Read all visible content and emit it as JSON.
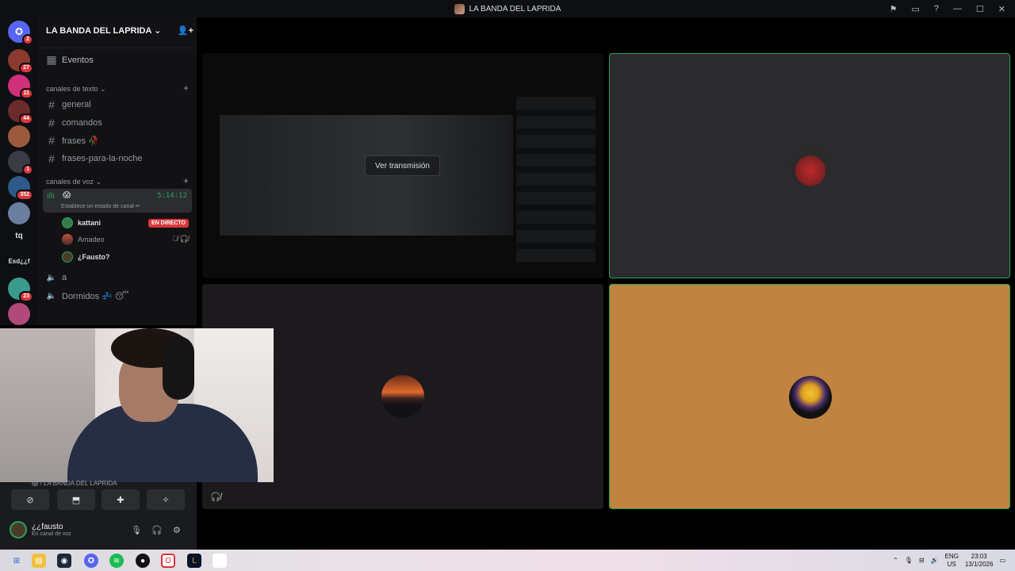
{
  "window": {
    "title": "LA BANDA DEL LAPRIDA"
  },
  "servers": {
    "home_badge": "2",
    "items": [
      {
        "badge": "27",
        "color": "#8b3a2f"
      },
      {
        "badge": "11",
        "color": "#d02f7a"
      },
      {
        "badge": "44",
        "color": "#6b2b2b"
      },
      {
        "badge": "",
        "color": "#9c5a3c"
      },
      {
        "badge": "1",
        "color": "#3a3c45"
      },
      {
        "badge": "352",
        "color": "#2d5a8a"
      },
      {
        "badge": "",
        "color": "#6a7fa0"
      }
    ],
    "text_servers": [
      "tq",
      "Esd¿¿f"
    ],
    "items2": [
      {
        "badge": "23",
        "color": "#3b9a8e"
      },
      {
        "badge": "",
        "color": "#b04a7a"
      }
    ]
  },
  "sidebar": {
    "server_name": "LA BANDA DEL LAPRIDA",
    "events": "Eventos",
    "text_category": "canales de texto",
    "text_channels": [
      "general",
      "comandos",
      "frases 🥀",
      "frases-para-la-noche"
    ],
    "voice_category": "canales de voz",
    "active_voice": {
      "emoji": "😱",
      "timer": "5:14:12",
      "status": "Establece un estado de canal ✏"
    },
    "voice_users": [
      {
        "name": "kattani",
        "live": "EN DIRECTO"
      },
      {
        "name": "Amadeo",
        "live": ""
      },
      {
        "name": "¿Fausto?",
        "live": ""
      }
    ],
    "other_voice": [
      "a",
      "Dormidos 💤 😴"
    ]
  },
  "stream": {
    "watch_label": "Ver transmisión"
  },
  "overlay": {
    "channel_path": "😱 / LA BANDA DEL LAPRIDA"
  },
  "user_panel": {
    "username": "¿¿fausto",
    "status": "En canal de voz"
  },
  "taskbar": {
    "lang": "ENG",
    "region": "US",
    "time": "23:03",
    "date": "13/1/2026"
  },
  "colors": {
    "accent_green": "#23a55a",
    "live_red": "#da373c",
    "tile_orange": "#c08440"
  }
}
